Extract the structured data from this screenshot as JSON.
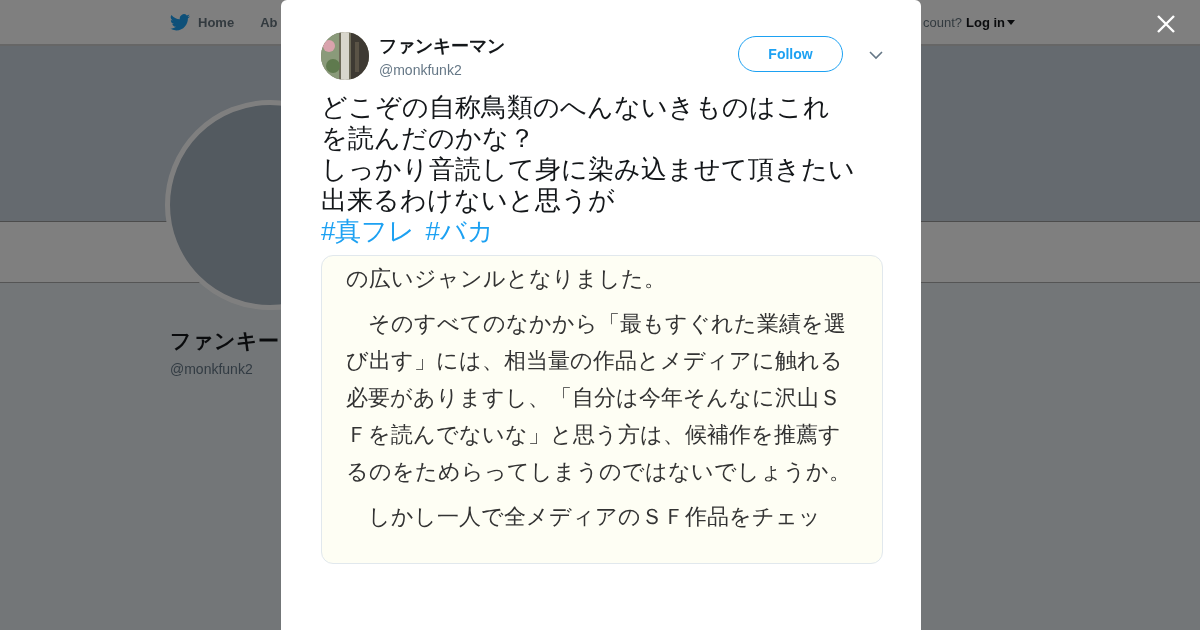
{
  "nav": {
    "items": [
      {
        "label": "Home"
      },
      {
        "label": "Ab"
      }
    ],
    "account_prompt": "count?",
    "login": "Log in"
  },
  "profile": {
    "name": "ファンキー",
    "handle": "@monkfunk2"
  },
  "tweet": {
    "name": "ファンキーマン",
    "handle": "@monkfunk2",
    "follow": "Follow",
    "lines": [
      "どこぞの自称鳥類のへんないきものはこれ",
      "を読んだのかな？",
      "しっかり音読して身に染み込ませて頂きたい",
      "出来るわけないと思うが"
    ],
    "hashtags": [
      "#真フレ",
      "#バカ"
    ],
    "media": {
      "paragraphs": [
        "の広いジャンルとなりました。",
        "　そのすべてのなかから「最もすぐれた業績を選び出す」には、相当量の作品とメディアに触れる必要がありますし、「自分は今年そんなに沢山ＳＦを読んでないな」と思う方は、候補作を推薦するのをためらってしまうのではないでしょうか。",
        "　しかし一人で全メディアのＳＦ作品をチェッ"
      ]
    }
  }
}
